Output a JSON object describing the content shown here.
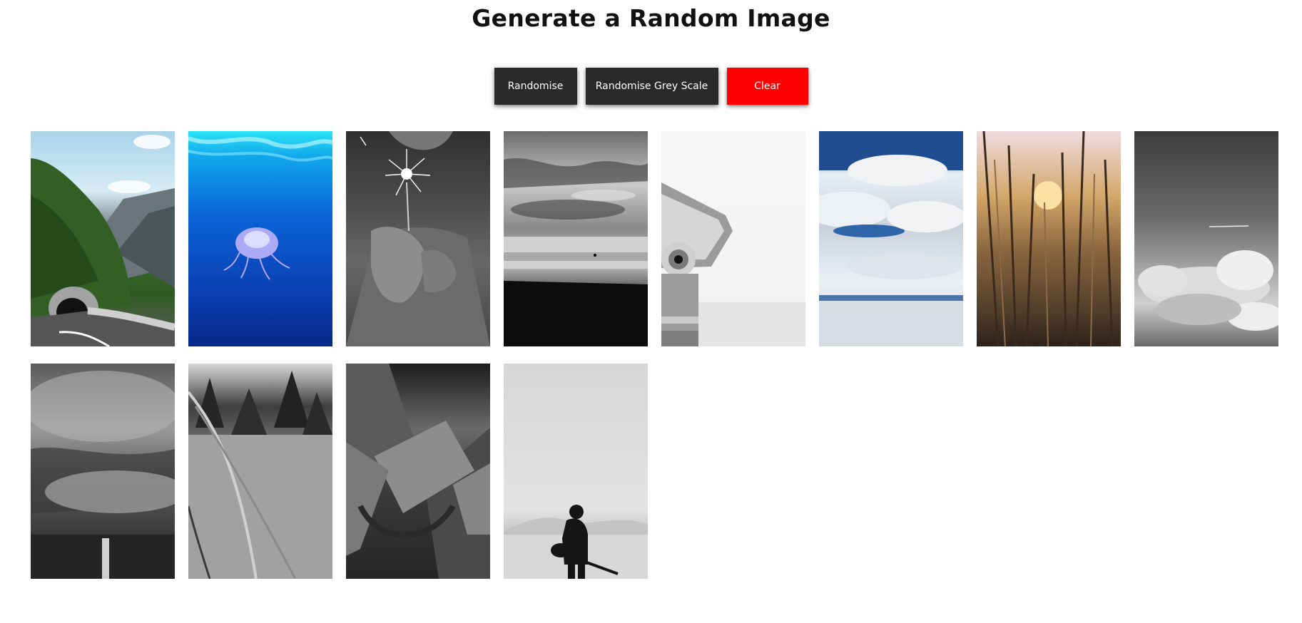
{
  "header": {
    "title": "Generate a Random Image"
  },
  "controls": {
    "randomise_label": "Randomise",
    "grey_label": "Randomise Grey Scale",
    "clear_label": "Clear",
    "colors": {
      "button_bg": "#2a2a2a",
      "clear_bg": "#ff0000",
      "button_text": "#ffffff"
    }
  },
  "gallery": {
    "images": [
      {
        "name": "mountain-road-tunnel-image",
        "greyscale": false
      },
      {
        "name": "jellyfish-underwater-image",
        "greyscale": false
      },
      {
        "name": "sparkler-hands-image",
        "greyscale": true
      },
      {
        "name": "beach-seascape-image",
        "greyscale": true
      },
      {
        "name": "coin-binoculars-image",
        "greyscale": true
      },
      {
        "name": "cloud-reflection-image",
        "greyscale": false
      },
      {
        "name": "sunset-reeds-image",
        "greyscale": false
      },
      {
        "name": "cloud-sky-image",
        "greyscale": true
      },
      {
        "name": "misty-forest-image",
        "greyscale": true
      },
      {
        "name": "tall-grass-trees-image",
        "greyscale": true
      },
      {
        "name": "arch-ceiling-image",
        "greyscale": true
      },
      {
        "name": "guitarist-desert-image",
        "greyscale": true
      }
    ]
  }
}
